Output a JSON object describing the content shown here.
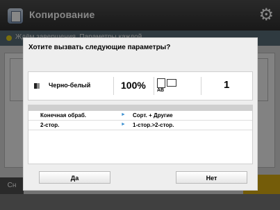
{
  "app": {
    "title": "Копирование",
    "icon": "copy-app-icon",
    "settings_icon": "gear-icon"
  },
  "status": {
    "text": "Ждём завершения. Параметры каждой"
  },
  "background": {
    "left_button_label": "Сн"
  },
  "dialog": {
    "title": "Хотите вызвать следующие параметры?",
    "summary": {
      "color_icon": "bw-icon",
      "color_mode": "Черно-белый",
      "zoom": "100%",
      "paper_icon": "paper-size-icon",
      "paper_mark": "АВ",
      "copies": "1"
    },
    "details": [
      {
        "label": "Конечная обраб.",
        "value": "Сорт. + Другие"
      },
      {
        "label": "2-стор.",
        "value": "1-стор.>2-стор."
      }
    ],
    "yes_label": "Да",
    "no_label": "Нет"
  },
  "colors": {
    "accent_arrow": "#3a8fd0",
    "status_dot": "#e7d11a"
  }
}
